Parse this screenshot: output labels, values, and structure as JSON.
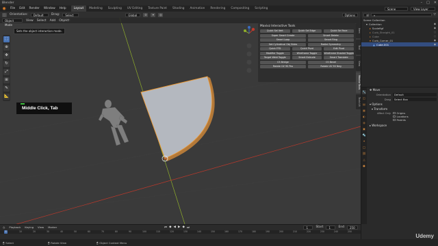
{
  "window": {
    "title": "Blender",
    "controls": [
      "–",
      "□",
      "✕"
    ]
  },
  "topbar": {
    "menus": [
      "File",
      "Edit",
      "Render",
      "Window",
      "Help"
    ],
    "workspaces": [
      "Layout",
      "Modeling",
      "Sculpting",
      "UV Editing",
      "Texture Paint",
      "Shading",
      "Animation",
      "Rendering",
      "Compositing",
      "Scripting"
    ],
    "active_workspace": "Layout",
    "scene": "Scene",
    "view_layer": "View Layer"
  },
  "viewport_header": {
    "orientation_label": "Orientation:",
    "orientation_value": "Default",
    "drag_label": "Drag:",
    "drag_value": "Select Box",
    "transform_orientation": "Global",
    "options": "Options"
  },
  "viewport_header2": {
    "mode": "Object Mode",
    "menus": [
      "View",
      "Select",
      "Add",
      "Object"
    ]
  },
  "tooltip": "Sets the object interaction mode.",
  "keycast": {
    "text": "Middle Click, Tab"
  },
  "npanel": {
    "title": "Maxivz Interactive Tools",
    "buttons3": [
      "Quick Sel Vert",
      "Quick Sel Edge",
      "Quick Sel Face",
      "Super Smart Create",
      "Smart Delete",
      "Smart Loop",
      "Smart Ring",
      "Set Cylindrical Obj Sides",
      "Radial Symmetry",
      "Quick FFD",
      "Quick Pivot",
      "Edit Pivot",
      "Modifier Toggle",
      "Wireframe Toggle",
      "Wireframe Shaded Toggle",
      "Target Weld Toggle",
      "Smart Extrude",
      "Smart Translate"
    ],
    "buttons2": [
      "CS Bridge",
      "CS Bevel",
      "Rotate UV 90 Pos",
      "Rotate UV 90 Neg"
    ],
    "side_tabs": [
      "Item",
      "Tool",
      "View",
      "Maxivz Tools",
      "Tools UV"
    ]
  },
  "outliner": {
    "rows": [
      {
        "label": "Scene Collection",
        "indent": 0,
        "state": "normal"
      },
      {
        "label": "Collection",
        "indent": 1,
        "state": "normal"
      },
      {
        "label": "Scalefigf",
        "indent": 2,
        "state": "normal"
      },
      {
        "label": "Curb_Straight_01",
        "indent": 2,
        "state": "dim"
      },
      {
        "label": "Cube",
        "indent": 2,
        "state": "dim"
      },
      {
        "label": "Curb_Corner_01",
        "indent": 2,
        "state": "normal"
      },
      {
        "label": "Cube.001",
        "indent": 3,
        "state": "sel"
      }
    ]
  },
  "properties": {
    "header": "Move",
    "orientation_label": "Orientation",
    "orientation_value": "Default",
    "drag_label": "Drag",
    "drag_value": "Select Box",
    "options_section": "Options",
    "transform_section": "Transform",
    "affect_only_label": "Affect Only",
    "checks": [
      "Origins",
      "Locations",
      "Parents"
    ],
    "workspace_section": "Workspace"
  },
  "timeline": {
    "menus": [
      "Playback",
      "Keying",
      "View",
      "Marker"
    ],
    "ticks": [
      "0",
      "10",
      "20",
      "30",
      "40",
      "50",
      "60",
      "70",
      "80",
      "90",
      "100",
      "110",
      "120",
      "130",
      "140",
      "150",
      "160",
      "170",
      "180",
      "190",
      "200",
      "210",
      "220",
      "230",
      "240",
      "250"
    ],
    "current_frame": "1",
    "start_label": "Start",
    "start_value": "1",
    "end_label": "End",
    "end_value": "250"
  },
  "statusbar": {
    "items": [
      "Select",
      "Rotate View",
      "Object Context Menu"
    ]
  },
  "watermark": "Udemy",
  "colors": {
    "accent_blue": "#4772b3",
    "selection_orange": "#f29c34",
    "axis_red": "#c0392b",
    "axis_green": "#8fae2b"
  }
}
